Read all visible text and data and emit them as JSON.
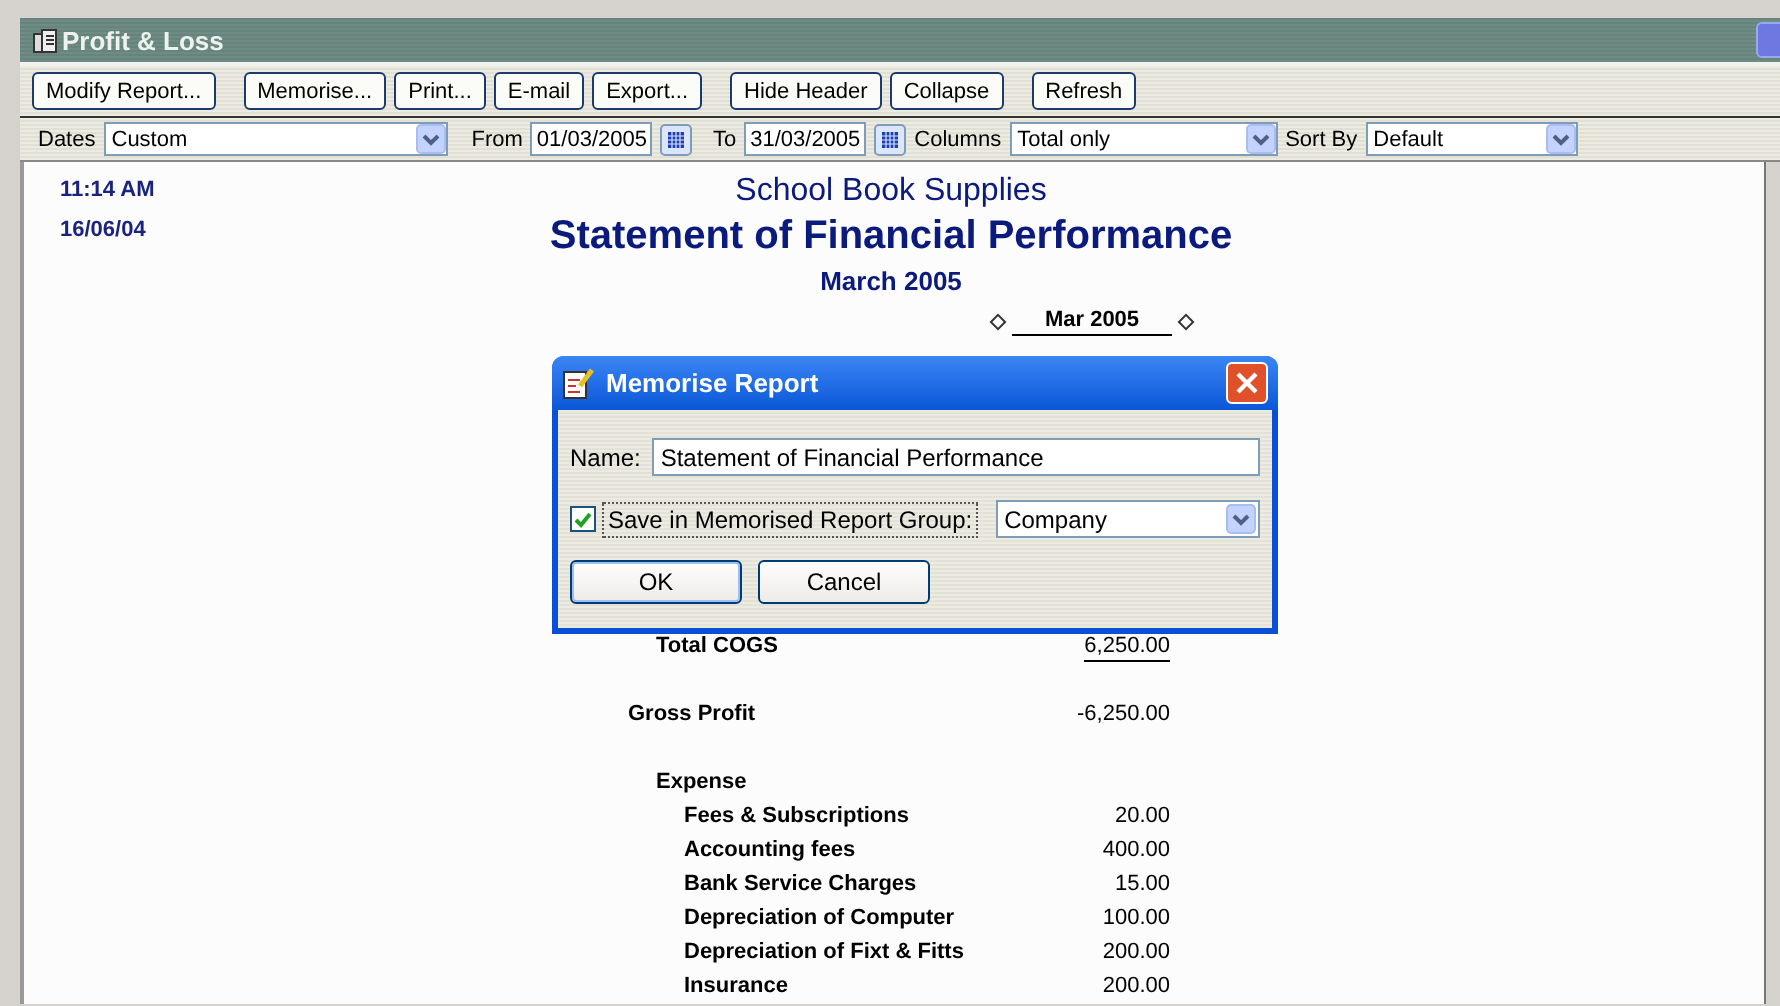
{
  "window": {
    "title": "Profit & Loss"
  },
  "toolbar": {
    "groups": [
      [
        "Modify Report..."
      ],
      [
        "Memorise...",
        "Print...",
        "E-mail",
        "Export..."
      ],
      [
        "Hide Header",
        "Collapse"
      ],
      [
        "Refresh"
      ]
    ]
  },
  "filters": {
    "dates_label": "Dates",
    "dates": "Custom",
    "from_label": "From",
    "from": "01/03/2005",
    "to_label": "To",
    "to": "31/03/2005",
    "columns_label": "Columns",
    "columns": "Total only",
    "sort_label": "Sort By",
    "sort": "Default"
  },
  "report": {
    "time": "11:14 AM",
    "date": "16/06/04",
    "company": "School Book Supplies",
    "title": "Statement of Financial Performance",
    "period": "March 2005",
    "column": "Mar 2005",
    "rows": [
      {
        "kind": "total",
        "label": "Total COGS",
        "amount": "6,250.00"
      },
      {
        "kind": "subtotal",
        "label": "Gross Profit",
        "amount": "-6,250.00"
      },
      {
        "kind": "group",
        "label": "Expense",
        "children": [
          {
            "label": "Fees & Subscriptions",
            "amount": "20.00"
          },
          {
            "label": "Accounting fees",
            "amount": "400.00"
          },
          {
            "label": "Bank Service Charges",
            "amount": "15.00"
          },
          {
            "label": "Depreciation of Computer",
            "amount": "100.00"
          },
          {
            "label": "Depreciation of Fixt & Fitts",
            "amount": "200.00"
          },
          {
            "label": "Insurance",
            "amount": "200.00"
          }
        ]
      }
    ]
  },
  "dialog": {
    "title": "Memorise Report",
    "name_label": "Name:",
    "name": "Statement of Financial Performance",
    "group_label": "Save in Memorised Report Group:",
    "group_checked": true,
    "group": "Company",
    "buttons": [
      "OK",
      "Cancel"
    ]
  }
}
